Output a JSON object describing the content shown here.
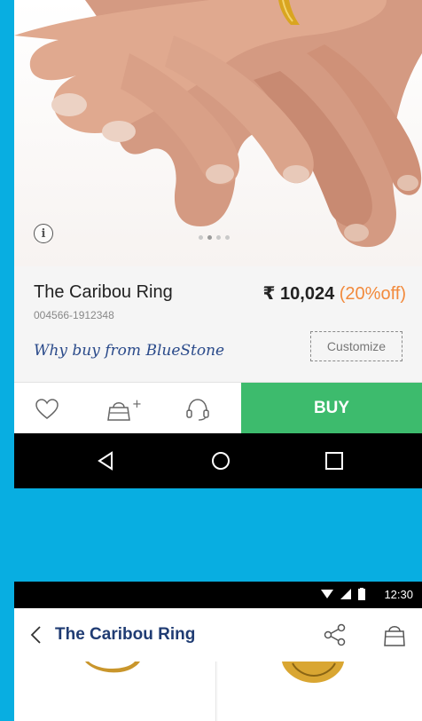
{
  "top_screen": {
    "product": {
      "title": "The Caribou Ring",
      "sku": "004566-1912348",
      "price": "₹ 10,024",
      "discount": "(20%off)",
      "why_buy": "Why buy from BlueStone",
      "customize_label": "Customize"
    },
    "carousel": {
      "total": 4,
      "active_index": 1
    },
    "action_bar": {
      "buy_label": "BUY",
      "icons": [
        "heart-icon",
        "add-to-bag-icon",
        "headset-icon"
      ]
    },
    "nav_bar": {
      "icons": [
        "back-triangle-icon",
        "home-circle-icon",
        "recents-square-icon"
      ]
    }
  },
  "bottom_screen": {
    "status_bar": {
      "time": "12:30"
    },
    "toolbar": {
      "title": "The Caribou Ring"
    }
  },
  "colors": {
    "background": "#08aee1",
    "buy_button": "#3dbb6d",
    "discount": "#f28a3c",
    "title_blue": "#203c73",
    "link_blue": "#2a4a8a"
  }
}
